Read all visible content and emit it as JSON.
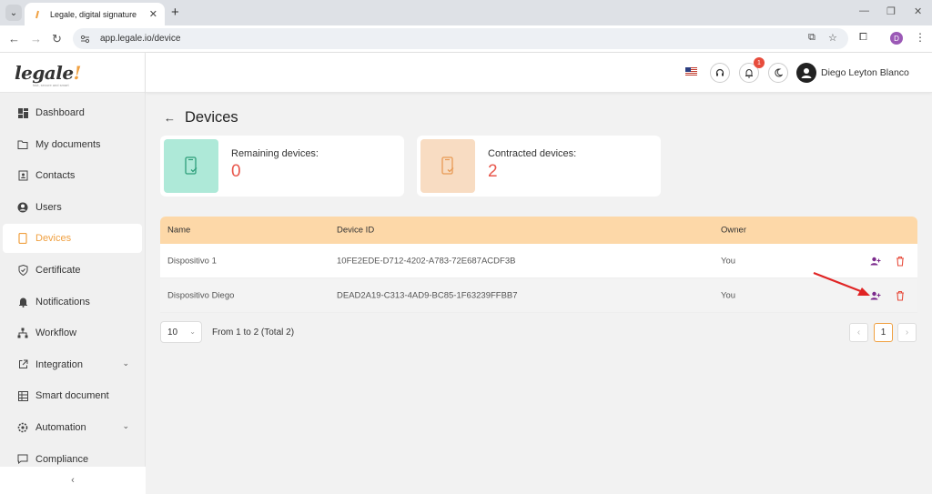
{
  "browser": {
    "tab_title": "Legale, digital signature",
    "url": "app.legale.io/device",
    "profile_initial": "D"
  },
  "app": {
    "logo": "legale",
    "logo_mark": "!",
    "logo_tagline": "fast, secure and smart",
    "brand_color": "#f0a040"
  },
  "sidebar": {
    "items": [
      {
        "label": "Dashboard",
        "icon": "grid-icon"
      },
      {
        "label": "My documents",
        "icon": "folder-icon"
      },
      {
        "label": "Contacts",
        "icon": "address-book-icon"
      },
      {
        "label": "Users",
        "icon": "user-circle-icon"
      },
      {
        "label": "Devices",
        "icon": "tablet-icon",
        "active": true
      },
      {
        "label": "Certificate",
        "icon": "shield-check-icon"
      },
      {
        "label": "Notifications",
        "icon": "bell-icon"
      },
      {
        "label": "Workflow",
        "icon": "workflow-icon"
      },
      {
        "label": "Integration",
        "icon": "external-link-icon",
        "expandable": true
      },
      {
        "label": "Smart document",
        "icon": "document-grid-icon"
      },
      {
        "label": "Automation",
        "icon": "gear-icon",
        "expandable": true
      },
      {
        "label": "Compliance",
        "icon": "chat-icon"
      }
    ],
    "collapse_label": "‹"
  },
  "header": {
    "notification_count": "1",
    "user_name": "Diego Leyton Blanco"
  },
  "page": {
    "title": "Devices",
    "stats": [
      {
        "label": "Remaining devices:",
        "value": "0",
        "bg": "#aee9d8",
        "icon_color": "#2e9f7a"
      },
      {
        "label": "Contracted devices:",
        "value": "2",
        "bg": "#f8dcc2",
        "icon_color": "#e89a55"
      }
    ],
    "table": {
      "headers": [
        "Name",
        "Device ID",
        "Owner"
      ],
      "rows": [
        {
          "name": "Dispositivo 1",
          "device_id": "10FE2EDE-D712-4202-A783-72E687ACDF3B",
          "owner": "You"
        },
        {
          "name": "Dispositivo Diego",
          "device_id": "DEAD2A19-C313-4AD9-BC85-1F63239FFBB7",
          "owner": "You"
        }
      ]
    },
    "pagination": {
      "page_size": "10",
      "info": "From 1 to 2 (Total 2)",
      "prev": "‹",
      "current": "1",
      "next": "›"
    }
  }
}
